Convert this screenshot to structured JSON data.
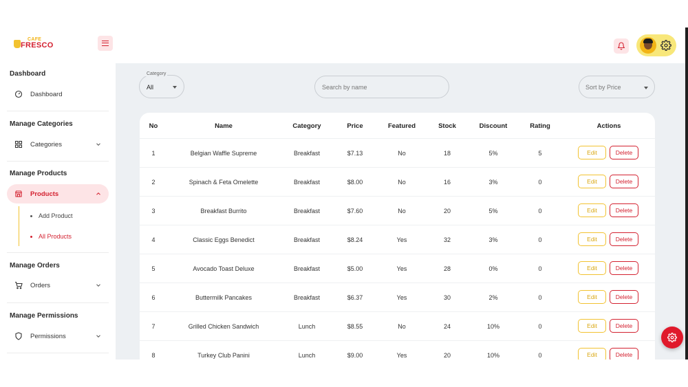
{
  "brand": {
    "line1": "CAFE",
    "line2": "FRESCO"
  },
  "header": {
    "menu_icon": "hamburger-icon",
    "bell_icon": "bell-icon",
    "settings_icon": "gear-icon"
  },
  "sidebar": {
    "sections": [
      {
        "heading": "Dashboard",
        "item": "Dashboard",
        "icon": "gauge-icon"
      },
      {
        "heading": "Manage Categories",
        "item": "Categories",
        "icon": "grid-icon"
      },
      {
        "heading": "Manage Products",
        "item": "Products",
        "icon": "store-icon",
        "subitems": [
          "Add Product",
          "All Products"
        ]
      },
      {
        "heading": "Manage Orders",
        "item": "Orders",
        "icon": "cart-icon"
      },
      {
        "heading": "Manage Permissions",
        "item": "Permissions",
        "icon": "shield-icon"
      }
    ]
  },
  "filters": {
    "category_label": "Category",
    "category_value": "All",
    "search_placeholder": "Search by name",
    "sort_value": "Sort by Price"
  },
  "table": {
    "columns": [
      "No",
      "Name",
      "Category",
      "Price",
      "Featured",
      "Stock",
      "Discount",
      "Rating",
      "Actions"
    ],
    "edit_label": "Edit",
    "delete_label": "Delete",
    "rows": [
      [
        "1",
        "Belgian Waffle Supreme",
        "Breakfast",
        "$7.13",
        "No",
        "18",
        "5%",
        "5"
      ],
      [
        "2",
        "Spinach & Feta Omelette",
        "Breakfast",
        "$8.00",
        "No",
        "16",
        "3%",
        "0"
      ],
      [
        "3",
        "Breakfast Burrito",
        "Breakfast",
        "$7.60",
        "No",
        "20",
        "5%",
        "0"
      ],
      [
        "4",
        "Classic Eggs Benedict",
        "Breakfast",
        "$8.24",
        "Yes",
        "32",
        "3%",
        "0"
      ],
      [
        "5",
        "Avocado Toast Deluxe",
        "Breakfast",
        "$5.00",
        "Yes",
        "28",
        "0%",
        "0"
      ],
      [
        "6",
        "Buttermilk Pancakes",
        "Breakfast",
        "$6.37",
        "Yes",
        "30",
        "2%",
        "0"
      ],
      [
        "7",
        "Grilled Chicken Sandwich",
        "Lunch",
        "$8.55",
        "No",
        "24",
        "10%",
        "0"
      ],
      [
        "8",
        "Turkey Club Panini",
        "Lunch",
        "$9.00",
        "Yes",
        "20",
        "10%",
        "0"
      ]
    ]
  },
  "colors": {
    "brand_red": "#d3202f",
    "accent_yellow": "#f2c230",
    "main_bg": "#edf0f3"
  }
}
